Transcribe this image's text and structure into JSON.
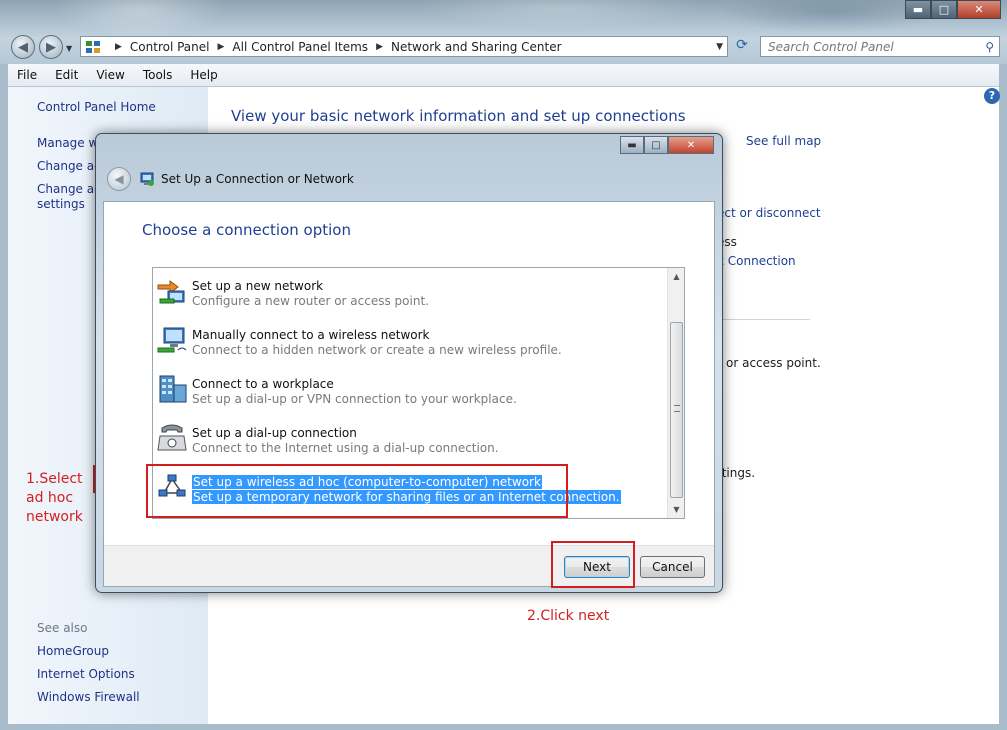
{
  "window": {
    "buttons": {
      "min": "▬",
      "max": "□",
      "close": "✕"
    }
  },
  "address": {
    "crumbs": [
      "Control Panel",
      "All Control Panel Items",
      "Network and Sharing Center"
    ],
    "search_placeholder": "Search Control Panel"
  },
  "menu": [
    "File",
    "Edit",
    "View",
    "Tools",
    "Help"
  ],
  "left_pane": {
    "home": "Control Panel Home",
    "manage": "Manage wi",
    "change_adapter": "Change ad",
    "change_adv_1": "Change ad",
    "change_adv_2": "settings",
    "see_also": "See also",
    "links": [
      "HomeGroup",
      "Internet Options",
      "Windows Firewall"
    ]
  },
  "main": {
    "heading": "View your basic network information and set up connections",
    "see_full_map": "See full map",
    "connect_disconnect": "ect or disconnect",
    "access_type": "ess",
    "connection": "k Connection",
    "access_point": "or access point.",
    "settings": "ttings."
  },
  "annotations": {
    "step1": [
      "1.Select",
      "ad hoc",
      "network"
    ],
    "step2": "2.Click next"
  },
  "dialog": {
    "title": "Set Up a Connection or Network",
    "heading": "Choose a connection option",
    "options": [
      {
        "title": "Set up a new network",
        "desc": "Configure a new router or access point.",
        "icon": "new-network-icon"
      },
      {
        "title": "Manually connect to a wireless network",
        "desc": "Connect to a hidden network or create a new wireless profile.",
        "icon": "wireless-network-icon"
      },
      {
        "title": "Connect to a workplace",
        "desc": "Set up a dial-up or VPN connection to your workplace.",
        "icon": "workplace-icon"
      },
      {
        "title": "Set up a dial-up connection",
        "desc": "Connect to the Internet using a dial-up connection.",
        "icon": "dialup-phone-icon"
      },
      {
        "title": "Set up a wireless ad hoc (computer-to-computer) network",
        "desc": "Set up a temporary network for sharing files or an Internet connection.",
        "icon": "adhoc-network-icon",
        "selected": true
      }
    ],
    "next_label": "Next",
    "cancel_label": "Cancel"
  }
}
